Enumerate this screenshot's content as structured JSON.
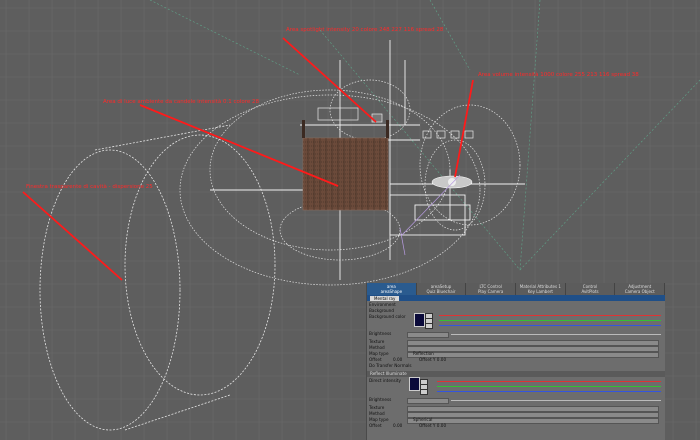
{
  "annotations": {
    "a1": "Area spotlight intensity 20 colore 248 227 116 spread 28",
    "a2": "Area volume intensità 1000 colore 255 213 116 spread 38",
    "a3": "Area di luce ambiente da candele intensità 0.1 colore 28",
    "a4": "Finestra trasparente di cavità - dispersione 25"
  },
  "panel": {
    "tabs": [
      {
        "label": "area",
        "sub": "areaShape"
      },
      {
        "label": "areaSetup",
        "sub": "Quiz Bluechair"
      },
      {
        "label": "LTC Control",
        "sub": "Play Camera"
      },
      {
        "label": "Material Attributes 1",
        "sub": "Key Lambert"
      },
      {
        "label": "Control",
        "sub": "AvitPlots"
      },
      {
        "label": "Adjustment",
        "sub": "Camera Object"
      }
    ],
    "subtab": "Mental ray",
    "rows": {
      "environment": "Environment",
      "background": "Background",
      "bg_color": "Background color",
      "brightness": "Brightness",
      "texture": "Texture",
      "method": "Method",
      "map_type": "Map type",
      "map_type_value": "Reflection",
      "offset_label": "Offset",
      "offset_value": "0.00",
      "offset2": "Offset Y  0.00",
      "custom": "Do Transfer Normals",
      "reflect_section": "Reflect Illuminate",
      "dir_light": "Direct intensity",
      "brightness2": "Brightness",
      "texture2": "Texture",
      "method2": "Method",
      "map_type2": "Map type",
      "map_type2_value": "Spherical",
      "offset3": "Offset",
      "offset3_value": "0.00",
      "offset4": "Offset Y  0.00"
    },
    "colors": {
      "accent": "#2a5b8f",
      "swatch": "#0a0a3a"
    }
  }
}
